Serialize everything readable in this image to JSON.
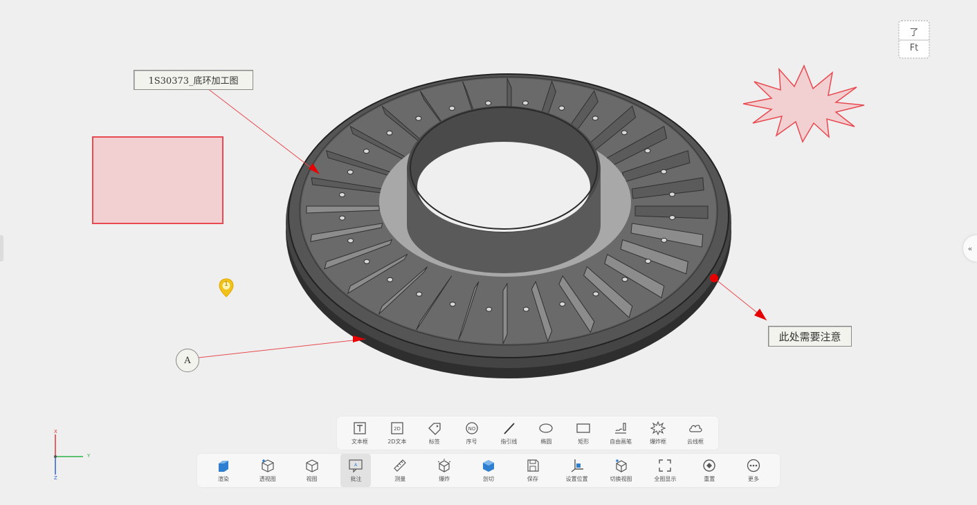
{
  "annotations": {
    "title_label": "1S30373_底环加工图",
    "attention_label": "此处需要注意",
    "balloon_label": "A",
    "marker_number": "1"
  },
  "view_cube": {
    "top_face": "了",
    "front_face": "Ft"
  },
  "side_panel": {
    "expand_glyph": "«"
  },
  "axes": {
    "x": "X",
    "y": "Y",
    "z": "Z"
  },
  "annotation_toolbar": [
    {
      "label": "文本框",
      "icon": "text-box-icon"
    },
    {
      "label": "2D文本",
      "icon": "2d-text-icon"
    },
    {
      "label": "标签",
      "icon": "tag-icon"
    },
    {
      "label": "序号",
      "icon": "sequence-number-icon"
    },
    {
      "label": "指引线",
      "icon": "leader-line-icon"
    },
    {
      "label": "椭圆",
      "icon": "ellipse-icon"
    },
    {
      "label": "矩形",
      "icon": "rectangle-icon"
    },
    {
      "label": "自由画笔",
      "icon": "free-pen-icon"
    },
    {
      "label": "爆炸框",
      "icon": "burst-box-icon"
    },
    {
      "label": "云线框",
      "icon": "cloud-box-icon"
    }
  ],
  "main_toolbar": [
    {
      "label": "渲染",
      "icon": "render-icon"
    },
    {
      "label": "透视图",
      "icon": "perspective-icon"
    },
    {
      "label": "视图",
      "icon": "view-icon"
    },
    {
      "label": "批注",
      "icon": "annotate-icon",
      "active": true
    },
    {
      "label": "测量",
      "icon": "measure-icon"
    },
    {
      "label": "爆炸",
      "icon": "explode-icon"
    },
    {
      "label": "剖切",
      "icon": "section-icon"
    },
    {
      "label": "保存",
      "icon": "save-icon"
    },
    {
      "label": "设置位置",
      "icon": "set-position-icon"
    },
    {
      "label": "切换视图",
      "icon": "switch-view-icon"
    },
    {
      "label": "全图显示",
      "icon": "fit-all-icon"
    },
    {
      "label": "重置",
      "icon": "reset-icon"
    },
    {
      "label": "更多",
      "icon": "more-icon"
    }
  ],
  "colors": {
    "annotation_red": "#e8484f",
    "annotation_fill": "#f2cfd1",
    "model_dark": "#3a3a3a",
    "model_light": "#9a9a9a",
    "accent_blue": "#2f7fd1",
    "marker_yellow": "#f1c21b"
  }
}
